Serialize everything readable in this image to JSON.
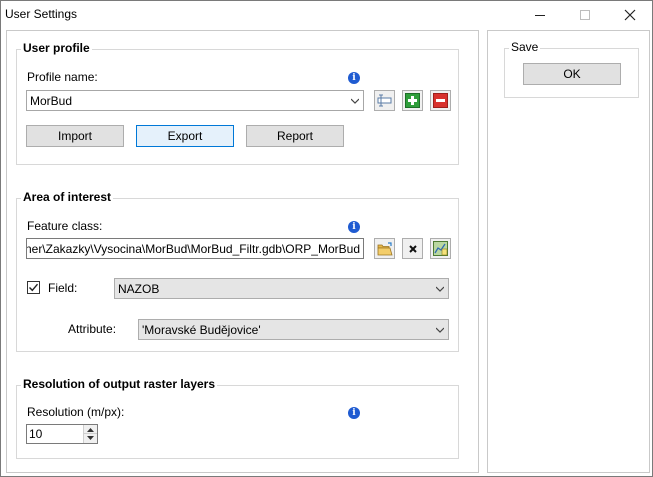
{
  "window": {
    "title": "User Settings",
    "controls": {
      "minimize": "minimize-icon",
      "maximize": "maximize-icon",
      "close": "close-icon"
    }
  },
  "user_profile": {
    "title": "User profile",
    "profile_name_label": "Profile name:",
    "profile_name_value": "MorBud",
    "buttons": {
      "import": "Import",
      "export": "Export",
      "report": "Report"
    },
    "icons": [
      "rename-icon",
      "add-icon",
      "remove-icon"
    ]
  },
  "area_of_interest": {
    "title": "Area of interest",
    "feature_class_label": "Feature class:",
    "feature_class_value": "ı Planner\\Zakazky\\Vysocina\\MorBud\\MorBud_Filtr.gdb\\ORP_MorBud",
    "field_label": "Field:",
    "field_checked": true,
    "field_value": "NAZOB",
    "attribute_label": "Attribute:",
    "attribute_value": "'Moravské Budějovice'",
    "icons": [
      "open-folder-icon",
      "clear-icon",
      "select-feature-icon"
    ]
  },
  "resolution": {
    "title": "Resolution of output raster layers",
    "label": "Resolution (m/px):",
    "value": "10"
  },
  "save": {
    "title": "Save",
    "ok_label": "OK"
  },
  "colors": {
    "accent": "#0078d7",
    "info_blue": "#1f5bd1",
    "add_green": "#2e9e3a",
    "remove_red": "#d8312d"
  }
}
